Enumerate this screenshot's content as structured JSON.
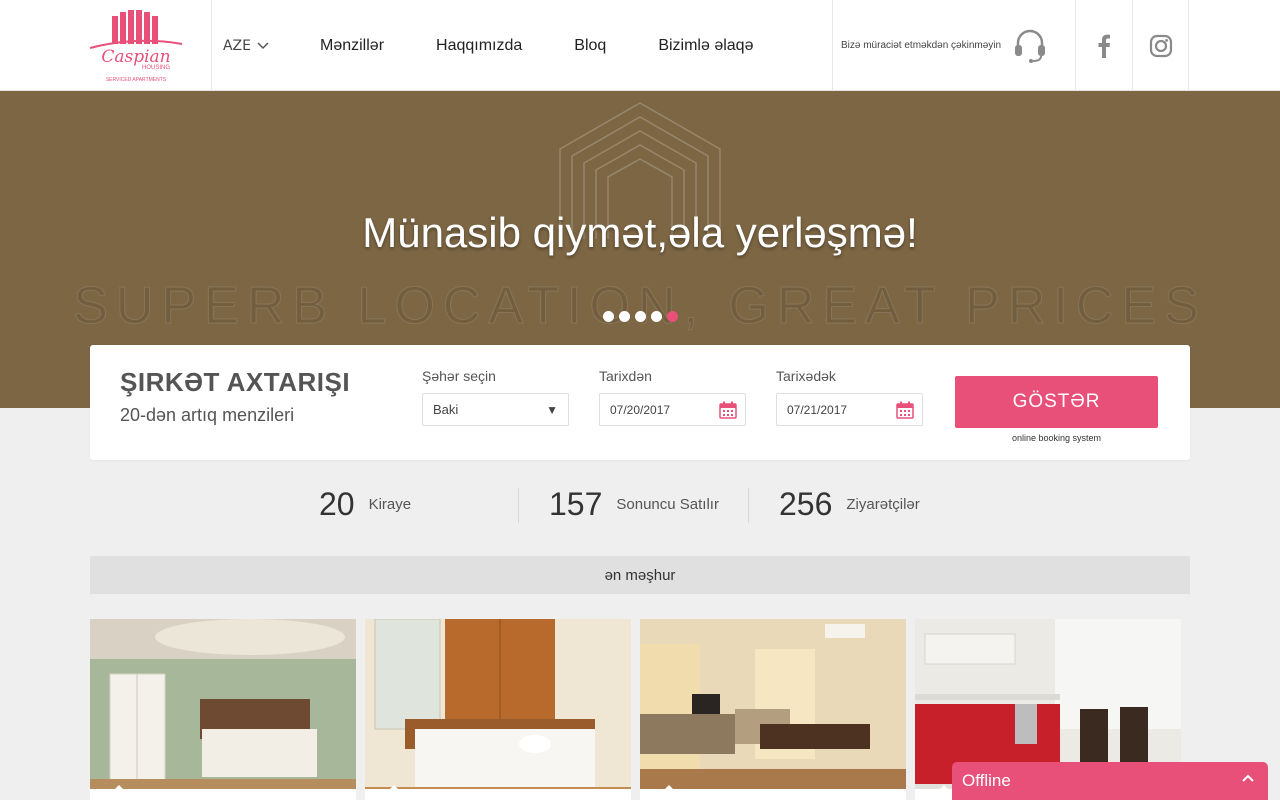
{
  "header": {
    "brand_name": "Caspian",
    "brand_sub": "HOUSING",
    "brand_tagline": "SERVICED APARTMENTS",
    "language": "AZE",
    "nav": [
      "Mənzillər",
      "Haqqımızda",
      "Bloq",
      "Bizimlə əlaqə"
    ],
    "contact_text": "Bizə müraciət etməkdən çəkinməyin",
    "icons": {
      "support": "headset-icon",
      "facebook": "facebook-icon",
      "instagram": "instagram-icon"
    }
  },
  "hero": {
    "title": "Münasib qiymət,əla yerləşmə!",
    "subtitle": "SUPERB LOCATION, GREAT PRICES",
    "slides_total": 5,
    "active_slide": 5
  },
  "search": {
    "title": "ŞIRKƏT AXTARIŞI",
    "subtitle": "20-dən artıq menzileri",
    "city_label": "Şəhər seçin",
    "city_value": "Baki",
    "from_label": "Tarixdən",
    "from_value": "07/20/2017",
    "to_label": "Tarixədək",
    "to_value": "07/21/2017",
    "button_label": "GÖSTƏR",
    "button_note": "online booking system"
  },
  "stats": [
    {
      "value": "20",
      "label": "Kiraye"
    },
    {
      "value": "157",
      "label": "Sonuncu Satılır"
    },
    {
      "value": "256",
      "label": "Ziyarətçilər"
    }
  ],
  "popular_title": "ən məşhur",
  "listings": [
    {
      "image": "bedroom-green-photo"
    },
    {
      "image": "bedroom-wood-photo"
    },
    {
      "image": "living-room-photo"
    },
    {
      "image": "kitchen-red-photo"
    }
  ],
  "chat": {
    "status": "Offline"
  },
  "colors": {
    "accent": "#e8507a",
    "hero_bg": "#7c6644",
    "page_bg": "#f0efef"
  }
}
